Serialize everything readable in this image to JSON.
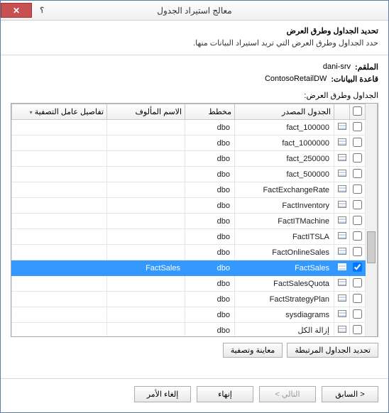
{
  "titlebar": {
    "title": "معالج استيراد الجدول",
    "help": "؟",
    "close": "✕"
  },
  "header": {
    "title": "تحديد الجداول وطرق العرض",
    "subtitle": "حدد الجداول وطرق العرض التي تريد استيراد البيانات منها."
  },
  "meta": {
    "server_label": "الملقم:",
    "server_value": "dani-srv",
    "db_label": "قاعدة البيانات:",
    "db_value": "ContosoRetailDW",
    "grid_label": "الجداول وطرق العرض:"
  },
  "columns": {
    "source": "الجدول المصدر",
    "schema": "مخطط",
    "alias": "الاسم المألوف",
    "filter": "تفاصيل عامل التصفية"
  },
  "rows": [
    {
      "source": "fact_100000",
      "schema": "dbo",
      "alias": "",
      "checked": false,
      "selected": false
    },
    {
      "source": "fact_1000000",
      "schema": "dbo",
      "alias": "",
      "checked": false,
      "selected": false
    },
    {
      "source": "fact_250000",
      "schema": "dbo",
      "alias": "",
      "checked": false,
      "selected": false
    },
    {
      "source": "fact_500000",
      "schema": "dbo",
      "alias": "",
      "checked": false,
      "selected": false
    },
    {
      "source": "FactExchangeRate",
      "schema": "dbo",
      "alias": "",
      "checked": false,
      "selected": false
    },
    {
      "source": "FactInventory",
      "schema": "dbo",
      "alias": "",
      "checked": false,
      "selected": false
    },
    {
      "source": "FactITMachine",
      "schema": "dbo",
      "alias": "",
      "checked": false,
      "selected": false
    },
    {
      "source": "FactITSLA",
      "schema": "dbo",
      "alias": "",
      "checked": false,
      "selected": false
    },
    {
      "source": "FactOnlineSales",
      "schema": "dbo",
      "alias": "",
      "checked": false,
      "selected": false
    },
    {
      "source": "FactSales",
      "schema": "dbo",
      "alias": "FactSales",
      "checked": true,
      "selected": true
    },
    {
      "source": "FactSalesQuota",
      "schema": "dbo",
      "alias": "",
      "checked": false,
      "selected": false
    },
    {
      "source": "FactStrategyPlan",
      "schema": "dbo",
      "alias": "",
      "checked": false,
      "selected": false
    },
    {
      "source": "sysdiagrams",
      "schema": "dbo",
      "alias": "",
      "checked": false,
      "selected": false
    },
    {
      "source": "إزالة الكل",
      "schema": "dbo",
      "alias": "",
      "checked": false,
      "selected": false
    }
  ],
  "buttons": {
    "related": "تحديد الجداول المرتبطة",
    "preview": "معاينة وتصفية",
    "back": "< السابق",
    "next": "التالي >",
    "finish": "إنهاء",
    "cancel": "إلغاء الأمر"
  }
}
